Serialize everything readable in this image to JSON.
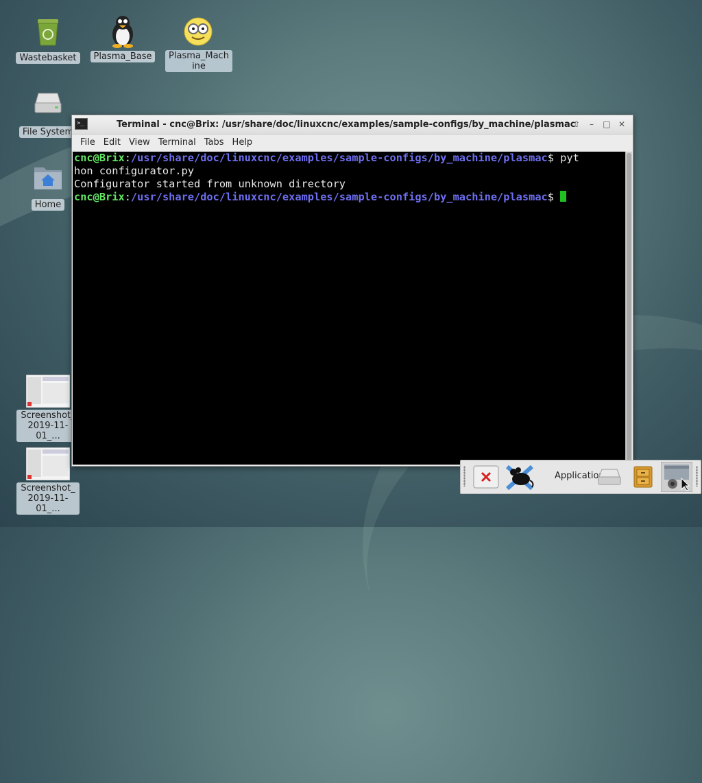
{
  "desktop": {
    "icons": [
      {
        "label": "Wastebasket",
        "icon": "trash-icon"
      },
      {
        "label": "Plasma_Base",
        "icon": "penguin-icon"
      },
      {
        "label": "Plasma_Machine",
        "icon": "face-glasses-icon"
      },
      {
        "label": "File System",
        "icon": "drive-icon"
      },
      {
        "label": "Home",
        "icon": "home-folder-icon"
      },
      {
        "label": "Screenshot_2019-11-01_...",
        "icon": "screenshot-thumbnail-icon"
      },
      {
        "label": "Screenshot_2019-11-01_...",
        "icon": "screenshot-thumbnail-icon"
      }
    ]
  },
  "terminal": {
    "title": "Terminal - cnc@Brix: /usr/share/doc/linuxcnc/examples/sample-configs/by_machine/plasmac",
    "menu": [
      "File",
      "Edit",
      "View",
      "Terminal",
      "Tabs",
      "Help"
    ],
    "prompt_user": "cnc@Brix",
    "prompt_sep": ":",
    "prompt_path": "/usr/share/doc/linuxcnc/examples/sample-configs/by_machine/plasmac",
    "prompt_end": "$ ",
    "command_part1": "pyt",
    "command_part2": "hon configurator.py",
    "output": "Configurator started from unknown directory",
    "colors": {
      "user": "#63e863",
      "path": "#6e6ef0",
      "cursor": "#21c021",
      "background": "#000000"
    }
  },
  "panel": {
    "applications_label": "Applications",
    "items": [
      "close-window-icon",
      "xfce-mouse-icon",
      "drive-icon",
      "file-cabinet-icon",
      "screenshot-tool-icon"
    ]
  }
}
